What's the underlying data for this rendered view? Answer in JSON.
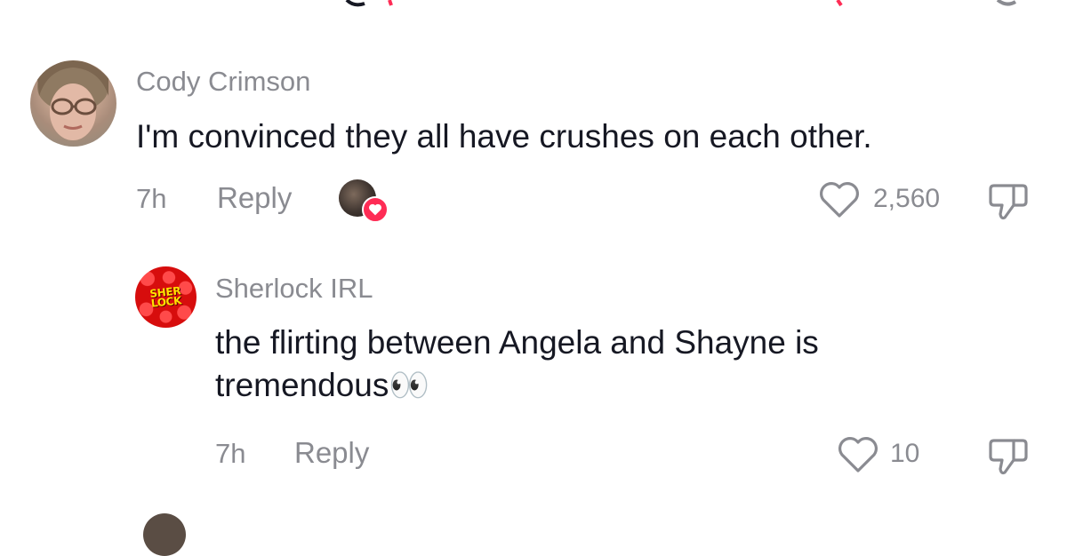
{
  "comments": [
    {
      "author": "Cody Crimson",
      "text": "I'm convinced they all have crushes on each other.",
      "time": "7h",
      "reply_label": "Reply",
      "like_count": "2,560",
      "avatar_icon": "avatar-photo",
      "creator_liked": true,
      "replies": [
        {
          "author": "Sherlock IRL",
          "avatar_logo_text": "SHER LOCK",
          "text": "the flirting between Angela and Shayne is tremendous👀",
          "time": "7h",
          "reply_label": "Reply",
          "like_count": "10"
        }
      ]
    }
  ],
  "colors": {
    "text_primary": "#161823",
    "text_secondary": "#8a8b91",
    "like_heart": "#fe2c55",
    "logo_red": "#d70d0d",
    "logo_yellow": "#ffe100"
  },
  "icons": [
    "heart-outline-icon",
    "thumbs-down-icon",
    "creator-liked-heart-icon"
  ]
}
